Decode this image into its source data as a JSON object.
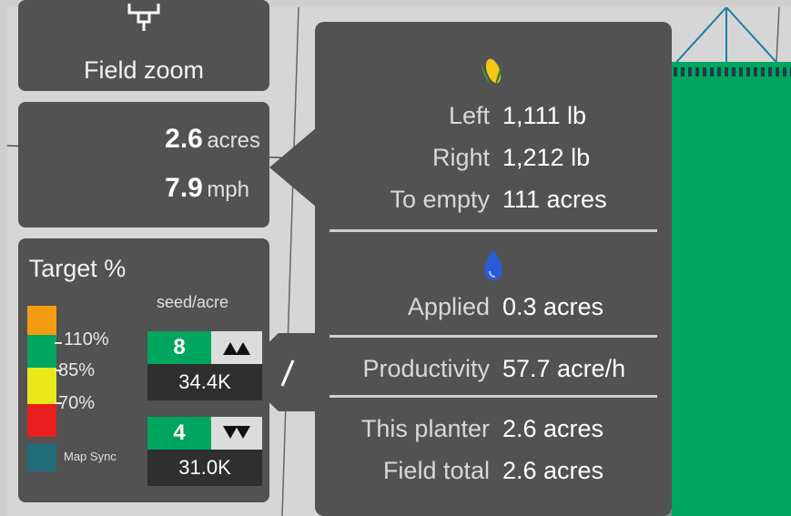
{
  "sidebar": {
    "field_zoom_label": "Field zoom",
    "stats": {
      "area_value": "2.6",
      "area_unit": "acres",
      "speed_value": "7.9",
      "speed_unit": "mph"
    },
    "target": {
      "title": "Target %",
      "unit": "seed/acre",
      "legend": [
        {
          "label": "110%",
          "color": "#f39c12"
        },
        {
          "label": "85%",
          "color": "#00a560"
        },
        {
          "label": "70%",
          "color": "#e8e81a"
        },
        {
          "label": "",
          "color": "#e81e1e"
        }
      ],
      "map_sync_label": "Map Sync",
      "map_sync_color": "#1f6b7a",
      "rates": [
        {
          "step": "8",
          "rate": "34.4K",
          "direction_icon": "increase-icon"
        },
        {
          "step": "4",
          "rate": "31.0K",
          "direction_icon": "decrease-icon"
        }
      ]
    }
  },
  "panel": {
    "seed_icon": "corn-icon",
    "seed_rows": [
      {
        "label": "Left",
        "value": "1,111 lb"
      },
      {
        "label": "Right",
        "value": "1,212 lb"
      },
      {
        "label": "To empty",
        "value": "111 acres"
      }
    ],
    "liquid_icon": "drop-icon",
    "applied": {
      "label": "Applied",
      "value": "0.3 acres"
    },
    "productivity": {
      "label": "Productivity",
      "value": "57.7 acre/h"
    },
    "totals": [
      {
        "label": "This planter",
        "value": "2.6 acres"
      },
      {
        "label": "Field total",
        "value": "2.6 acres"
      }
    ]
  },
  "colors": {
    "card_bg": "#525252",
    "accent_green": "#00a560",
    "map_bg": "#d6d6d6"
  }
}
